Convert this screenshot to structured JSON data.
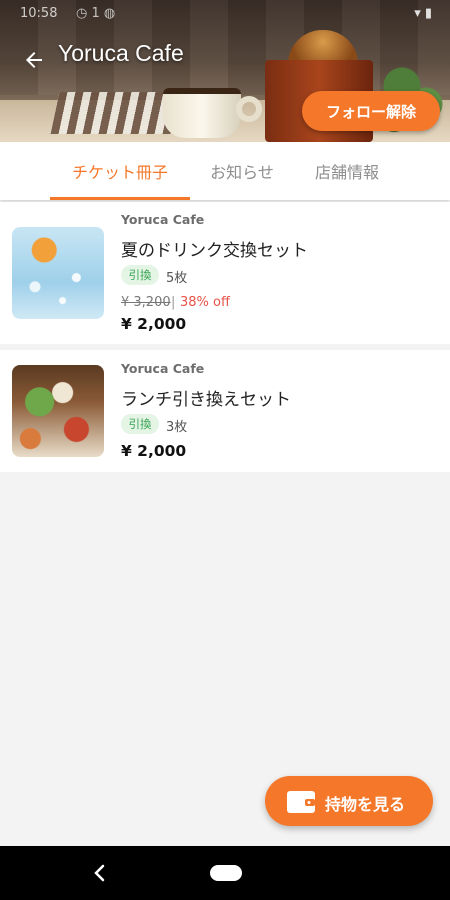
{
  "status_bar": {
    "time": "10:58",
    "indicators": "◷  1  ◍",
    "right": "▾ ▮"
  },
  "header": {
    "title": "Yoruca Cafe",
    "back_icon": "arrow-left-icon",
    "unfollow_label": "フォロー解除"
  },
  "tabs": [
    {
      "label": "チケット冊子",
      "active": true
    },
    {
      "label": "お知らせ",
      "active": false
    },
    {
      "label": "店舗情報",
      "active": false
    }
  ],
  "tickets": [
    {
      "shop": "Yoruca Cafe",
      "title": "夏のドリンク交換セット",
      "badge": "引換",
      "count": "5枚",
      "original_price": "¥ 3,200",
      "separator": "|",
      "discount": "38% off",
      "price": "¥ 2,000"
    },
    {
      "shop": "Yoruca Cafe",
      "title": "ランチ引き換えセット",
      "badge": "引換",
      "count": "3枚",
      "price": "¥ 2,000"
    }
  ],
  "fab": {
    "label": "持物を見る",
    "icon": "wallet-icon"
  },
  "colors": {
    "accent": "#f5782a",
    "badge_bg": "#e4f5e6",
    "badge_text": "#36a352",
    "discount": "#e8534a"
  }
}
